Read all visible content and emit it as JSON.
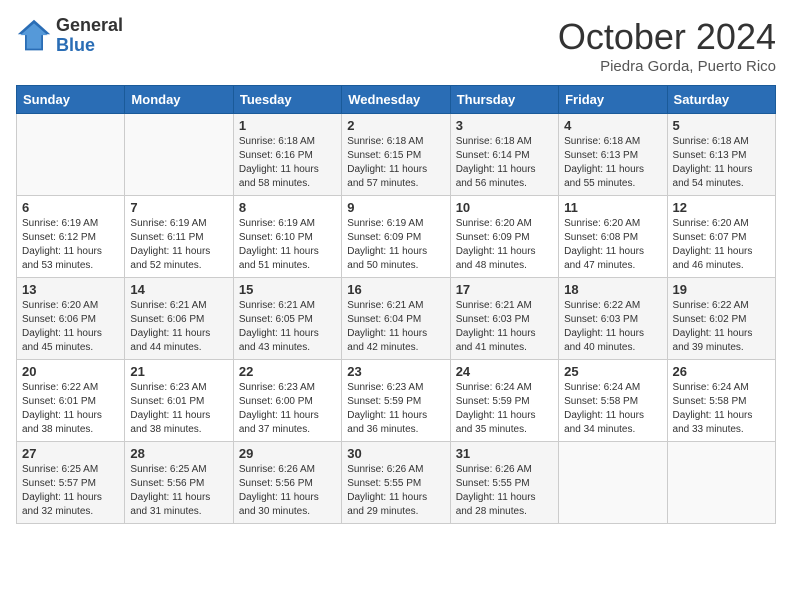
{
  "header": {
    "logo_general": "General",
    "logo_blue": "Blue",
    "month_title": "October 2024",
    "subtitle": "Piedra Gorda, Puerto Rico"
  },
  "days_of_week": [
    "Sunday",
    "Monday",
    "Tuesday",
    "Wednesday",
    "Thursday",
    "Friday",
    "Saturday"
  ],
  "weeks": [
    [
      {
        "day": "",
        "info": ""
      },
      {
        "day": "",
        "info": ""
      },
      {
        "day": "1",
        "info": "Sunrise: 6:18 AM\nSunset: 6:16 PM\nDaylight: 11 hours and 58 minutes."
      },
      {
        "day": "2",
        "info": "Sunrise: 6:18 AM\nSunset: 6:15 PM\nDaylight: 11 hours and 57 minutes."
      },
      {
        "day": "3",
        "info": "Sunrise: 6:18 AM\nSunset: 6:14 PM\nDaylight: 11 hours and 56 minutes."
      },
      {
        "day": "4",
        "info": "Sunrise: 6:18 AM\nSunset: 6:13 PM\nDaylight: 11 hours and 55 minutes."
      },
      {
        "day": "5",
        "info": "Sunrise: 6:18 AM\nSunset: 6:13 PM\nDaylight: 11 hours and 54 minutes."
      }
    ],
    [
      {
        "day": "6",
        "info": "Sunrise: 6:19 AM\nSunset: 6:12 PM\nDaylight: 11 hours and 53 minutes."
      },
      {
        "day": "7",
        "info": "Sunrise: 6:19 AM\nSunset: 6:11 PM\nDaylight: 11 hours and 52 minutes."
      },
      {
        "day": "8",
        "info": "Sunrise: 6:19 AM\nSunset: 6:10 PM\nDaylight: 11 hours and 51 minutes."
      },
      {
        "day": "9",
        "info": "Sunrise: 6:19 AM\nSunset: 6:09 PM\nDaylight: 11 hours and 50 minutes."
      },
      {
        "day": "10",
        "info": "Sunrise: 6:20 AM\nSunset: 6:09 PM\nDaylight: 11 hours and 48 minutes."
      },
      {
        "day": "11",
        "info": "Sunrise: 6:20 AM\nSunset: 6:08 PM\nDaylight: 11 hours and 47 minutes."
      },
      {
        "day": "12",
        "info": "Sunrise: 6:20 AM\nSunset: 6:07 PM\nDaylight: 11 hours and 46 minutes."
      }
    ],
    [
      {
        "day": "13",
        "info": "Sunrise: 6:20 AM\nSunset: 6:06 PM\nDaylight: 11 hours and 45 minutes."
      },
      {
        "day": "14",
        "info": "Sunrise: 6:21 AM\nSunset: 6:06 PM\nDaylight: 11 hours and 44 minutes."
      },
      {
        "day": "15",
        "info": "Sunrise: 6:21 AM\nSunset: 6:05 PM\nDaylight: 11 hours and 43 minutes."
      },
      {
        "day": "16",
        "info": "Sunrise: 6:21 AM\nSunset: 6:04 PM\nDaylight: 11 hours and 42 minutes."
      },
      {
        "day": "17",
        "info": "Sunrise: 6:21 AM\nSunset: 6:03 PM\nDaylight: 11 hours and 41 minutes."
      },
      {
        "day": "18",
        "info": "Sunrise: 6:22 AM\nSunset: 6:03 PM\nDaylight: 11 hours and 40 minutes."
      },
      {
        "day": "19",
        "info": "Sunrise: 6:22 AM\nSunset: 6:02 PM\nDaylight: 11 hours and 39 minutes."
      }
    ],
    [
      {
        "day": "20",
        "info": "Sunrise: 6:22 AM\nSunset: 6:01 PM\nDaylight: 11 hours and 38 minutes."
      },
      {
        "day": "21",
        "info": "Sunrise: 6:23 AM\nSunset: 6:01 PM\nDaylight: 11 hours and 38 minutes."
      },
      {
        "day": "22",
        "info": "Sunrise: 6:23 AM\nSunset: 6:00 PM\nDaylight: 11 hours and 37 minutes."
      },
      {
        "day": "23",
        "info": "Sunrise: 6:23 AM\nSunset: 5:59 PM\nDaylight: 11 hours and 36 minutes."
      },
      {
        "day": "24",
        "info": "Sunrise: 6:24 AM\nSunset: 5:59 PM\nDaylight: 11 hours and 35 minutes."
      },
      {
        "day": "25",
        "info": "Sunrise: 6:24 AM\nSunset: 5:58 PM\nDaylight: 11 hours and 34 minutes."
      },
      {
        "day": "26",
        "info": "Sunrise: 6:24 AM\nSunset: 5:58 PM\nDaylight: 11 hours and 33 minutes."
      }
    ],
    [
      {
        "day": "27",
        "info": "Sunrise: 6:25 AM\nSunset: 5:57 PM\nDaylight: 11 hours and 32 minutes."
      },
      {
        "day": "28",
        "info": "Sunrise: 6:25 AM\nSunset: 5:56 PM\nDaylight: 11 hours and 31 minutes."
      },
      {
        "day": "29",
        "info": "Sunrise: 6:26 AM\nSunset: 5:56 PM\nDaylight: 11 hours and 30 minutes."
      },
      {
        "day": "30",
        "info": "Sunrise: 6:26 AM\nSunset: 5:55 PM\nDaylight: 11 hours and 29 minutes."
      },
      {
        "day": "31",
        "info": "Sunrise: 6:26 AM\nSunset: 5:55 PM\nDaylight: 11 hours and 28 minutes."
      },
      {
        "day": "",
        "info": ""
      },
      {
        "day": "",
        "info": ""
      }
    ]
  ]
}
